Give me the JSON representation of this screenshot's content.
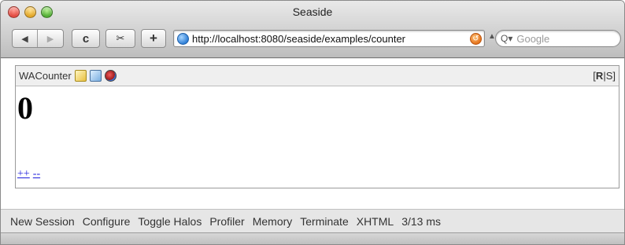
{
  "window": {
    "title": "Seaside"
  },
  "toolbar": {
    "back_glyph": "◀",
    "forward_glyph": "▶",
    "reload_glyph": "c",
    "snapshot_glyph": "✂",
    "add_bookmark_glyph": "+",
    "url": "http://localhost:8080/seaside/examples/counter",
    "snapback_glyph": "↺",
    "url_dropdown_glyph": "▲",
    "search_placeholder": "Google",
    "search_icon_glyph": "Q▾"
  },
  "halo": {
    "component_name": "WACounter",
    "icons": [
      "edit-icon",
      "inspect-icon",
      "style-icon"
    ],
    "render_mode": {
      "r": "R",
      "separator": "|",
      "s": "S",
      "open": "[",
      "close": "]"
    }
  },
  "counter": {
    "value": "0",
    "increment_label": "++",
    "decrement_label": "--"
  },
  "devbar": {
    "items": [
      "New Session",
      "Configure",
      "Toggle Halos",
      "Profiler",
      "Memory",
      "Terminate",
      "XHTML",
      "3/13 ms"
    ]
  },
  "colors": {
    "link": "#1a1adb",
    "close": "#e0443a",
    "minimize": "#e0a21f",
    "zoom": "#4aa82c"
  }
}
